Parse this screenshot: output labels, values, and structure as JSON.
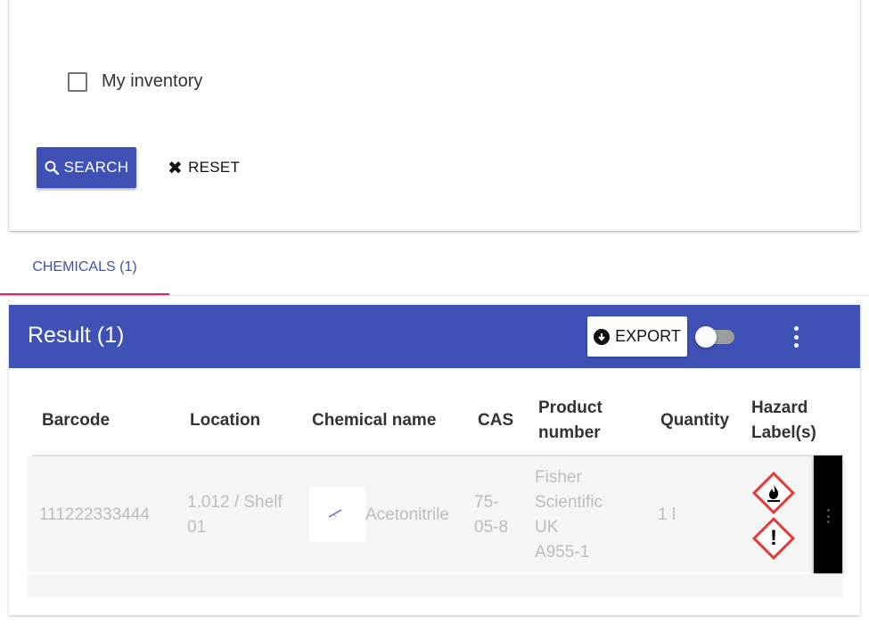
{
  "search_form": {
    "my_inventory_label": "My inventory",
    "search_label": "SEARCH",
    "reset_label": "RESET"
  },
  "tabs": [
    {
      "label": "CHEMICALS (1)",
      "active": true
    }
  ],
  "results": {
    "title": "Result (1)",
    "export_label": "EXPORT",
    "columns": [
      "Barcode",
      "Location",
      "Chemical name",
      "CAS",
      "Product",
      "number",
      "Quantity",
      "Hazard",
      "Label(s)"
    ],
    "rows": [
      {
        "barcode": "111222333444",
        "location_line1": "1.012 / Shelf",
        "location_line2": "01",
        "chemical_name": "Acetonitrile",
        "cas_line1": "75-",
        "cas_line2": "05-8",
        "product_line1": "Fisher",
        "product_line2": "Scientific",
        "product_line3": "UK",
        "product_line4": "A955-1",
        "quantity": "1 l",
        "hazards": [
          "flame-icon",
          "exclamation-icon"
        ]
      }
    ]
  },
  "colors": {
    "primary": "#3f51b5",
    "tab_indicator": "#e91e63",
    "hazard_red": "#e53935"
  }
}
